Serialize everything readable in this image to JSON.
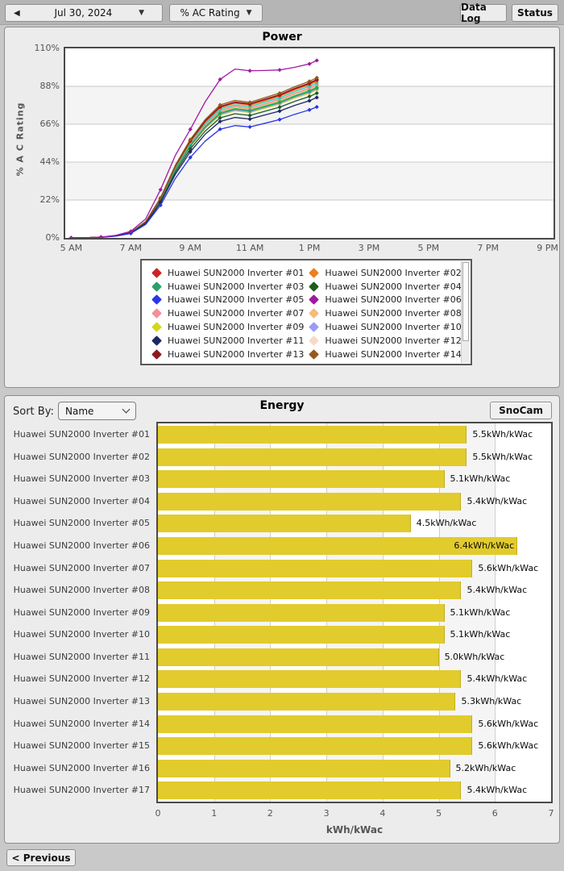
{
  "toolbar": {
    "back_icon": "◀",
    "date_label": "Jul 30, 2024",
    "caret": "▼",
    "metric_label": "% AC Rating",
    "data_log_label": "Data Log",
    "status_label": "Status"
  },
  "power": {
    "title": "Power",
    "ylabel": "% A C Rating",
    "legend_items": [
      {
        "label": "Huawei SUN2000 Inverter #01",
        "color": "#cc2227"
      },
      {
        "label": "Huawei SUN2000 Inverter #02",
        "color": "#ee7f1d"
      },
      {
        "label": "Huawei SUN2000 Inverter #03",
        "color": "#2f9e68"
      },
      {
        "label": "Huawei SUN2000 Inverter #04",
        "color": "#1e5b1e"
      },
      {
        "label": "Huawei SUN2000 Inverter #05",
        "color": "#2a35e8"
      },
      {
        "label": "Huawei SUN2000 Inverter #06",
        "color": "#a019a0"
      },
      {
        "label": "Huawei SUN2000 Inverter #07",
        "color": "#f4909a"
      },
      {
        "label": "Huawei SUN2000 Inverter #08",
        "color": "#f3bc77"
      },
      {
        "label": "Huawei SUN2000 Inverter #09",
        "color": "#d6d51f"
      },
      {
        "label": "Huawei SUN2000 Inverter #10",
        "color": "#9b9bf7"
      },
      {
        "label": "Huawei SUN2000 Inverter #11",
        "color": "#1d2766"
      },
      {
        "label": "Huawei SUN2000 Inverter #12",
        "color": "#f8d9c4"
      },
      {
        "label": "Huawei SUN2000 Inverter #13",
        "color": "#8e191c"
      },
      {
        "label": "Huawei SUN2000 Inverter #14",
        "color": "#95591d"
      }
    ]
  },
  "energy": {
    "title": "Energy",
    "sort_by_label": "Sort By:",
    "sort_value": "Name",
    "snocam_label": "SnoCam"
  },
  "bottom": {
    "previous_label": "< Previous"
  },
  "chart_data": [
    {
      "type": "line",
      "title": "Power",
      "ylabel": "% A C Rating",
      "xlim": [
        4.8,
        21.2
      ],
      "ylim": [
        0,
        110
      ],
      "grid": "horizontal",
      "band_color": "#f4f4f4",
      "yticks": [
        {
          "v": 110,
          "label": "110%"
        },
        {
          "v": 88,
          "label": "88%"
        },
        {
          "v": 66,
          "label": "66%"
        },
        {
          "v": 44,
          "label": "44%"
        },
        {
          "v": 22,
          "label": "22%"
        },
        {
          "v": 0,
          "label": "0%"
        }
      ],
      "xticks": [
        {
          "v": 5,
          "label": "5 AM"
        },
        {
          "v": 7,
          "label": "7 AM"
        },
        {
          "v": 9,
          "label": "9 AM"
        },
        {
          "v": 11,
          "label": "11 AM"
        },
        {
          "v": 13,
          "label": "1 PM"
        },
        {
          "v": 15,
          "label": "3 PM"
        },
        {
          "v": 17,
          "label": "5 PM"
        },
        {
          "v": 19,
          "label": "7 PM"
        },
        {
          "v": 21,
          "label": "9 PM"
        }
      ],
      "x": [
        5,
        5.5,
        6,
        6.5,
        7,
        7.5,
        8,
        8.5,
        9,
        9.5,
        10,
        10.5,
        11,
        11.5,
        12,
        12.5,
        13,
        13.25
      ],
      "draw_order": [
        11,
        7,
        16,
        6,
        8,
        9,
        15,
        2,
        14,
        1,
        0,
        12,
        13,
        3,
        10,
        4,
        5
      ],
      "series": [
        {
          "name": "Huawei SUN2000 Inverter #01",
          "color": "#cc2227",
          "values": [
            0,
            0.1,
            0.4,
            1.2,
            3.1,
            9.4,
            22.9,
            41.6,
            56.2,
            67.6,
            75.9,
            78.5,
            77.5,
            80.1,
            82.7,
            86.3,
            89.4,
            91.5
          ]
        },
        {
          "name": "Huawei SUN2000 Inverter #02",
          "color": "#ee7f1d",
          "values": [
            0,
            0.1,
            0.4,
            1.2,
            3.1,
            9.3,
            22.8,
            41.4,
            55.8,
            67.2,
            75.5,
            78.1,
            77,
            79.6,
            82.2,
            85.8,
            88.9,
            91
          ]
        },
        {
          "name": "Huawei SUN2000 Inverter #03",
          "color": "#2f9e68",
          "values": [
            0,
            0.1,
            0.4,
            1.2,
            3,
            8.9,
            21.8,
            39.5,
            53.4,
            64.3,
            72.2,
            74.7,
            73.7,
            76.1,
            78.6,
            82.1,
            85,
            87
          ]
        },
        {
          "name": "Huawei SUN2000 Inverter #04",
          "color": "#1e5b1e",
          "values": [
            0,
            0.1,
            0.4,
            1.1,
            2.9,
            8.6,
            21,
            38.2,
            51.6,
            62,
            69.7,
            72.1,
            71.1,
            73.5,
            75.9,
            79.2,
            82.1,
            84
          ]
        },
        {
          "name": "Huawei SUN2000 Inverter #05",
          "color": "#2a35e8",
          "values": [
            0,
            0.1,
            0.3,
            1,
            2.6,
            7.8,
            19,
            34.6,
            46.7,
            56.2,
            63.1,
            65.2,
            64.4,
            66.5,
            68.7,
            71.7,
            74.3,
            76
          ]
        },
        {
          "name": "Huawei SUN2000 Inverter #06",
          "color": "#a019a0",
          "values": [
            0,
            0.1,
            0.5,
            1.5,
            3.8,
            11,
            28,
            48,
            63,
            79,
            92,
            98,
            97,
            97.2,
            97.5,
            99,
            101,
            103
          ]
        },
        {
          "name": "Huawei SUN2000 Inverter #07",
          "color": "#f4909a",
          "values": [
            0,
            0.1,
            0.4,
            1.2,
            3,
            9.1,
            22.2,
            40.5,
            54.6,
            65.7,
            73.8,
            76.4,
            75.3,
            77.9,
            80.4,
            83.9,
            87,
            89
          ]
        },
        {
          "name": "Huawei SUN2000 Inverter #08",
          "color": "#f3bc77",
          "values": [
            0,
            0.1,
            0.4,
            1.2,
            3,
            9.1,
            22.1,
            40.2,
            54.3,
            65.4,
            73.4,
            76,
            74.9,
            77.4,
            80,
            83.5,
            86.5,
            88.5
          ]
        },
        {
          "name": "Huawei SUN2000 Inverter #09",
          "color": "#d6d51f",
          "values": [
            0,
            0.1,
            0.4,
            1.2,
            2.9,
            8.8,
            21.5,
            39.1,
            52.8,
            63.5,
            71.3,
            73.8,
            72.8,
            75.2,
            77.7,
            81.1,
            84,
            86
          ]
        },
        {
          "name": "Huawei SUN2000 Inverter #10",
          "color": "#9b9bf7",
          "values": [
            0,
            0.1,
            0.4,
            1.2,
            2.9,
            8.8,
            21.6,
            39.3,
            53.1,
            63.9,
            71.8,
            74.2,
            73.2,
            75.7,
            78.1,
            81.6,
            84.5,
            86.5
          ]
        },
        {
          "name": "Huawei SUN2000 Inverter #11",
          "color": "#1d2766",
          "values": [
            0,
            0.1,
            0.4,
            1.1,
            2.8,
            8.3,
            20.4,
            37,
            50,
            60.2,
            67.6,
            69.9,
            69,
            71.3,
            73.6,
            76.9,
            79.6,
            81.5
          ]
        },
        {
          "name": "Huawei SUN2000 Inverter #12",
          "color": "#f8d9c4",
          "values": [
            0,
            0.1,
            0.4,
            1.2,
            3,
            9,
            22,
            40,
            54,
            65,
            73,
            75.5,
            74.5,
            77,
            79.5,
            83,
            86,
            88
          ]
        },
        {
          "name": "Huawei SUN2000 Inverter #13",
          "color": "#8e191c",
          "values": [
            0,
            0.1,
            0.4,
            1.3,
            3.1,
            9.4,
            23,
            41.8,
            56.4,
            67.9,
            76.3,
            78.9,
            77.9,
            80.5,
            83.1,
            86.8,
            89.9,
            92
          ]
        },
        {
          "name": "Huawei SUN2000 Inverter #14",
          "color": "#95591d",
          "values": [
            0,
            0.1,
            0.4,
            1.3,
            3.2,
            9.5,
            23.3,
            42.3,
            57.1,
            68.7,
            77.2,
            79.8,
            78.7,
            81.4,
            84,
            87.7,
            90.9,
            93
          ]
        },
        {
          "name": "Huawei SUN2000 Inverter #15",
          "color": "#17d3c0",
          "values": [
            0,
            0.1,
            0.4,
            1.2,
            3.1,
            9.2,
            22.5,
            40.9,
            55.2,
            66.5,
            74.7,
            77.2,
            76.2,
            78.8,
            81.3,
            84.9,
            88,
            90
          ]
        },
        {
          "name": "Huawei SUN2000 Inverter #16",
          "color": "#3fc93f",
          "values": [
            0,
            0.1,
            0.4,
            1.2,
            3,
            8.9,
            21.9,
            39.8,
            53.7,
            64.6,
            72.6,
            75.1,
            74.1,
            76.6,
            79,
            82.5,
            85.5,
            87.5
          ]
        },
        {
          "name": "Huawei SUN2000 Inverter #17",
          "color": "#d98841",
          "values": [
            0,
            0.1,
            0.4,
            1.2,
            3,
            9,
            21.7,
            39.6,
            53.5,
            64.5,
            72.4,
            74.9,
            73.9,
            76.4,
            78.8,
            82.3,
            85.3,
            87.2
          ]
        }
      ]
    },
    {
      "type": "bar",
      "title": "Energy",
      "xlabel": "kWh/kWac",
      "xlim": [
        0,
        7
      ],
      "xticks": [
        0,
        1,
        2,
        3,
        4,
        5,
        6,
        7
      ],
      "bar_color": "#e2cb2d",
      "value_suffix": "kWh/kWac",
      "categories": [
        "Huawei SUN2000 Inverter #01",
        "Huawei SUN2000 Inverter #02",
        "Huawei SUN2000 Inverter #03",
        "Huawei SUN2000 Inverter #04",
        "Huawei SUN2000 Inverter #05",
        "Huawei SUN2000 Inverter #06",
        "Huawei SUN2000 Inverter #07",
        "Huawei SUN2000 Inverter #08",
        "Huawei SUN2000 Inverter #09",
        "Huawei SUN2000 Inverter #10",
        "Huawei SUN2000 Inverter #11",
        "Huawei SUN2000 Inverter #12",
        "Huawei SUN2000 Inverter #13",
        "Huawei SUN2000 Inverter #14",
        "Huawei SUN2000 Inverter #15",
        "Huawei SUN2000 Inverter #16",
        "Huawei SUN2000 Inverter #17"
      ],
      "values": [
        5.5,
        5.5,
        5.1,
        5.4,
        4.5,
        6.4,
        5.6,
        5.4,
        5.1,
        5.1,
        5.0,
        5.4,
        5.3,
        5.6,
        5.6,
        5.2,
        5.4
      ]
    }
  ]
}
